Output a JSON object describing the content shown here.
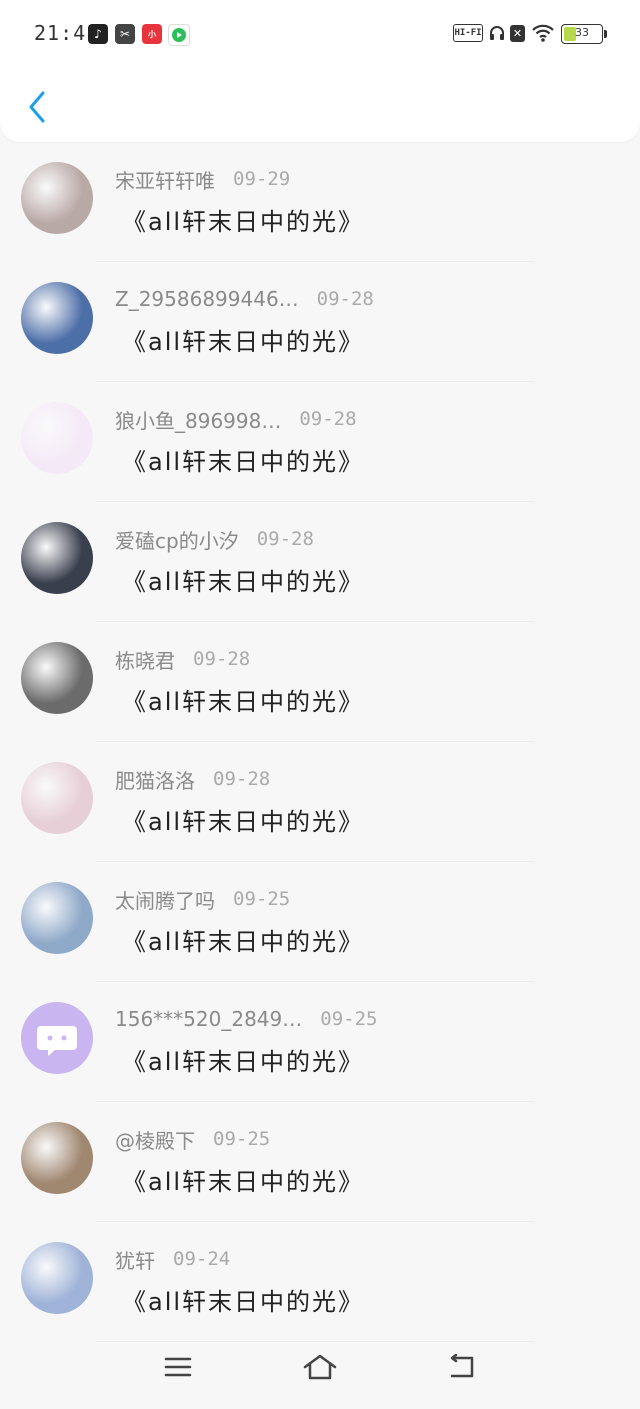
{
  "status_bar": {
    "time": "21:41",
    "hifi_label": "HI-FI",
    "battery_level": "33",
    "battery_fraction": 0.33
  },
  "header": {
    "back_icon": "chevron-left-icon",
    "accent_color": "#1aa0e8"
  },
  "comments": [
    {
      "user": "宋亚轩轩唯",
      "date": "09-29",
      "title": "《all轩末日中的光》",
      "avatar_color": "#b9a9a6"
    },
    {
      "user": "Z_29586899446…",
      "date": "09-28",
      "title": "《all轩末日中的光》",
      "avatar_color": "#4d6fa8"
    },
    {
      "user": "狼小鱼_896998…",
      "date": "09-28",
      "title": "《all轩末日中的光》",
      "avatar_color": "#f4eaf7"
    },
    {
      "user": "爱磕cp的小汐",
      "date": "09-28",
      "title": "《all轩末日中的光》",
      "avatar_color": "#3a3f4d"
    },
    {
      "user": "栋晓君",
      "date": "09-28",
      "title": "《all轩末日中的光》",
      "avatar_color": "#6b6b6b"
    },
    {
      "user": "肥猫洛洛",
      "date": "09-28",
      "title": "《all轩末日中的光》",
      "avatar_color": "#e6cfd6"
    },
    {
      "user": "太闹腾了吗",
      "date": "09-25",
      "title": "《all轩末日中的光》",
      "avatar_color": "#8fa9c9"
    },
    {
      "user": "156***520_2849…",
      "date": "09-25",
      "title": "《all轩末日中的光》",
      "avatar_color": "#c9b6f0"
    },
    {
      "user": "@棱殿下",
      "date": "09-25",
      "title": "《all轩末日中的光》",
      "avatar_color": "#a08770"
    },
    {
      "user": "犹轩",
      "date": "09-24",
      "title": "《all轩末日中的光》",
      "avatar_color": "#9fb3d8"
    }
  ],
  "nav": {
    "menu_icon": "menu-icon",
    "home_icon": "home-icon",
    "back_icon": "back-icon"
  }
}
